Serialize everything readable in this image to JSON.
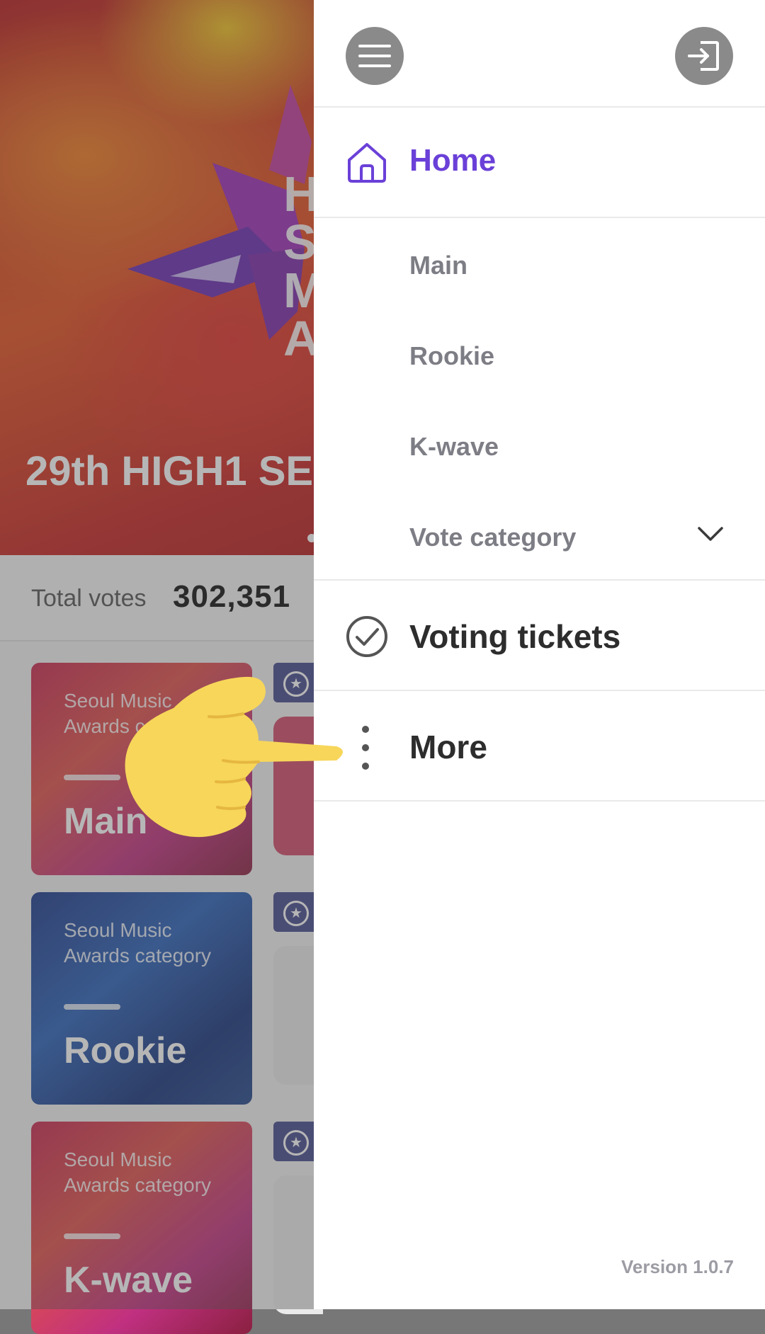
{
  "background": {
    "hero_title": "29th HIGH1 SE",
    "hero_tag": "H\nS\nM\nA",
    "total_votes_label": "Total votes",
    "total_votes_value": "302,351",
    "cards": [
      {
        "subtitle": "Seoul Music Awards category",
        "name": "Main"
      },
      {
        "subtitle": "Seoul Music Awards category",
        "name": "Rookie"
      },
      {
        "subtitle": "Seoul Music Awards category",
        "name": "K-wave"
      }
    ]
  },
  "drawer": {
    "menu_icon": "hamburger-menu-icon",
    "login_icon": "login-icon",
    "home": {
      "label": "Home",
      "icon": "home-icon",
      "color": "#6a40d8"
    },
    "sub_items": [
      "Main",
      "Rookie",
      "K-wave"
    ],
    "vote_category": {
      "label": "Vote category",
      "icon": "chevron-down-icon"
    },
    "voting_tickets": {
      "label": "Voting tickets",
      "icon": "check-circle-icon"
    },
    "more": {
      "label": "More",
      "icon": "more-vertical-icon"
    },
    "version": "Version 1.0.7"
  },
  "overlay": {
    "icon": "pointing-hand-icon",
    "color": "#f7d65a"
  }
}
